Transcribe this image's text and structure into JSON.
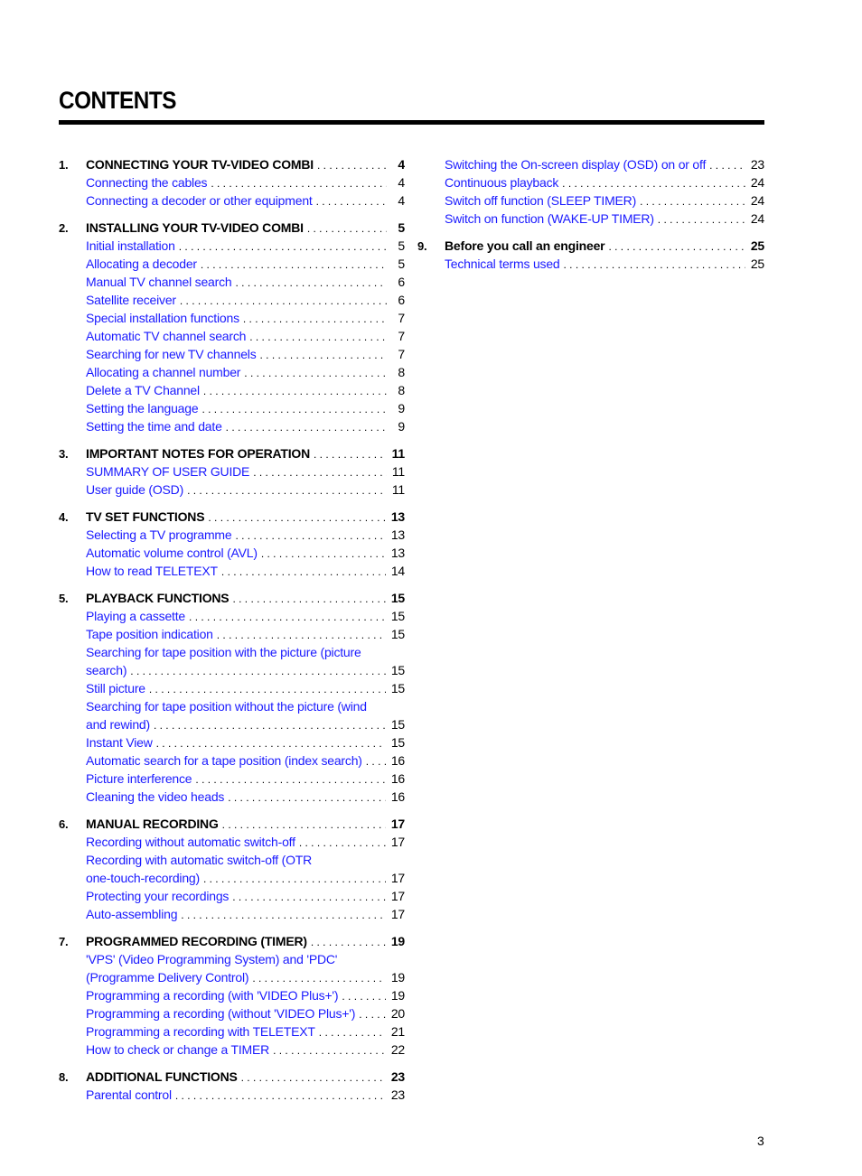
{
  "title": "CONTENTS",
  "page_number": "3",
  "left_column": [
    {
      "number": "1.",
      "heading": "CONNECTING YOUR TV-VIDEO COMBI",
      "page": "4",
      "items": [
        {
          "label": "Connecting the cables",
          "page": "4"
        },
        {
          "label": "Connecting a decoder or other equipment",
          "page": "4"
        }
      ]
    },
    {
      "number": "2.",
      "heading": "INSTALLING YOUR TV-VIDEO COMBI",
      "page": "5",
      "items": [
        {
          "label": "Initial installation",
          "page": "5"
        },
        {
          "label": "Allocating a decoder",
          "page": "5"
        },
        {
          "label": "Manual TV channel search",
          "page": "6"
        },
        {
          "label": "Satellite receiver",
          "page": "6"
        },
        {
          "label": "Special installation functions",
          "page": "7"
        },
        {
          "label": "Automatic TV channel search",
          "page": "7"
        },
        {
          "label": "Searching for new TV channels",
          "page": "7"
        },
        {
          "label": "Allocating a channel number",
          "page": "8"
        },
        {
          "label": "Delete a TV Channel",
          "page": "8"
        },
        {
          "label": "Setting the language",
          "page": "9"
        },
        {
          "label": "Setting the time and date",
          "page": "9"
        }
      ]
    },
    {
      "number": "3.",
      "heading": "IMPORTANT NOTES FOR OPERATION",
      "page": "11",
      "items": [
        {
          "label": "SUMMARY OF USER GUIDE",
          "page": "11"
        },
        {
          "label": "User guide (OSD)",
          "page": "11"
        }
      ]
    },
    {
      "number": "4.",
      "heading": "TV SET FUNCTIONS",
      "page": "13",
      "items": [
        {
          "label": "Selecting a TV programme",
          "page": "13"
        },
        {
          "label": "Automatic volume control (AVL)",
          "page": "13"
        },
        {
          "label": "How to read TELETEXT",
          "page": "14"
        }
      ]
    },
    {
      "number": "5.",
      "heading": "PLAYBACK FUNCTIONS",
      "page": "15",
      "items": [
        {
          "label": "Playing a cassette",
          "page": "15"
        },
        {
          "label": "Tape position indication",
          "page": "15"
        },
        {
          "label": "Searching for tape position with the picture (picture",
          "continuation": "search)",
          "page": "15"
        },
        {
          "label": "Still picture",
          "page": "15"
        },
        {
          "label": "Searching for tape position without the picture (wind",
          "continuation": "and rewind)",
          "page": "15"
        },
        {
          "label": "Instant View",
          "page": "15"
        },
        {
          "label": "Automatic search for a tape position (index search)",
          "page": "16"
        },
        {
          "label": "Picture interference",
          "page": "16"
        },
        {
          "label": "Cleaning the video heads",
          "page": "16"
        }
      ]
    },
    {
      "number": "6.",
      "heading": "MANUAL RECORDING",
      "page": "17",
      "items": [
        {
          "label": "Recording without automatic switch-off",
          "page": "17"
        },
        {
          "label": "Recording with automatic switch-off (OTR",
          "continuation": "one-touch-recording)",
          "page": "17"
        },
        {
          "label": "Protecting your recordings",
          "page": "17"
        },
        {
          "label": "Auto-assembling",
          "page": "17"
        }
      ]
    },
    {
      "number": "7.",
      "heading": "PROGRAMMED RECORDING (TIMER)",
      "page": "19",
      "items": [
        {
          "label": "'VPS' (Video Programming System) and 'PDC'",
          "continuation": "(Programme Delivery Control)",
          "page": "19"
        },
        {
          "label": "Programming a recording (with 'VIDEO Plus+')",
          "page": "19"
        },
        {
          "label": "Programming a recording (without 'VIDEO Plus+')",
          "page": "20"
        },
        {
          "label": "Programming a recording with TELETEXT",
          "page": "21"
        },
        {
          "label": "How to check or change a TIMER",
          "page": "22"
        }
      ]
    },
    {
      "number": "8.",
      "heading": "ADDITIONAL FUNCTIONS",
      "page": "23",
      "items": [
        {
          "label": "Parental control",
          "page": "23"
        }
      ]
    }
  ],
  "right_column": [
    {
      "number": "",
      "heading": "",
      "page": "",
      "items": [
        {
          "label": "Switching the On-screen display (OSD) on or off",
          "page": "23"
        },
        {
          "label": "Continuous playback",
          "page": "24"
        },
        {
          "label": "Switch off function (SLEEP TIMER)",
          "page": "24"
        },
        {
          "label": "Switch on function (WAKE-UP TIMER)",
          "page": "24"
        }
      ]
    },
    {
      "number": "9.",
      "heading": "Before you call an engineer",
      "page": "25",
      "items": [
        {
          "label": "Technical terms used",
          "page": "25"
        }
      ]
    }
  ],
  "colors": {
    "link": "#1a1aff",
    "text": "#000000",
    "rule": "#000000"
  }
}
